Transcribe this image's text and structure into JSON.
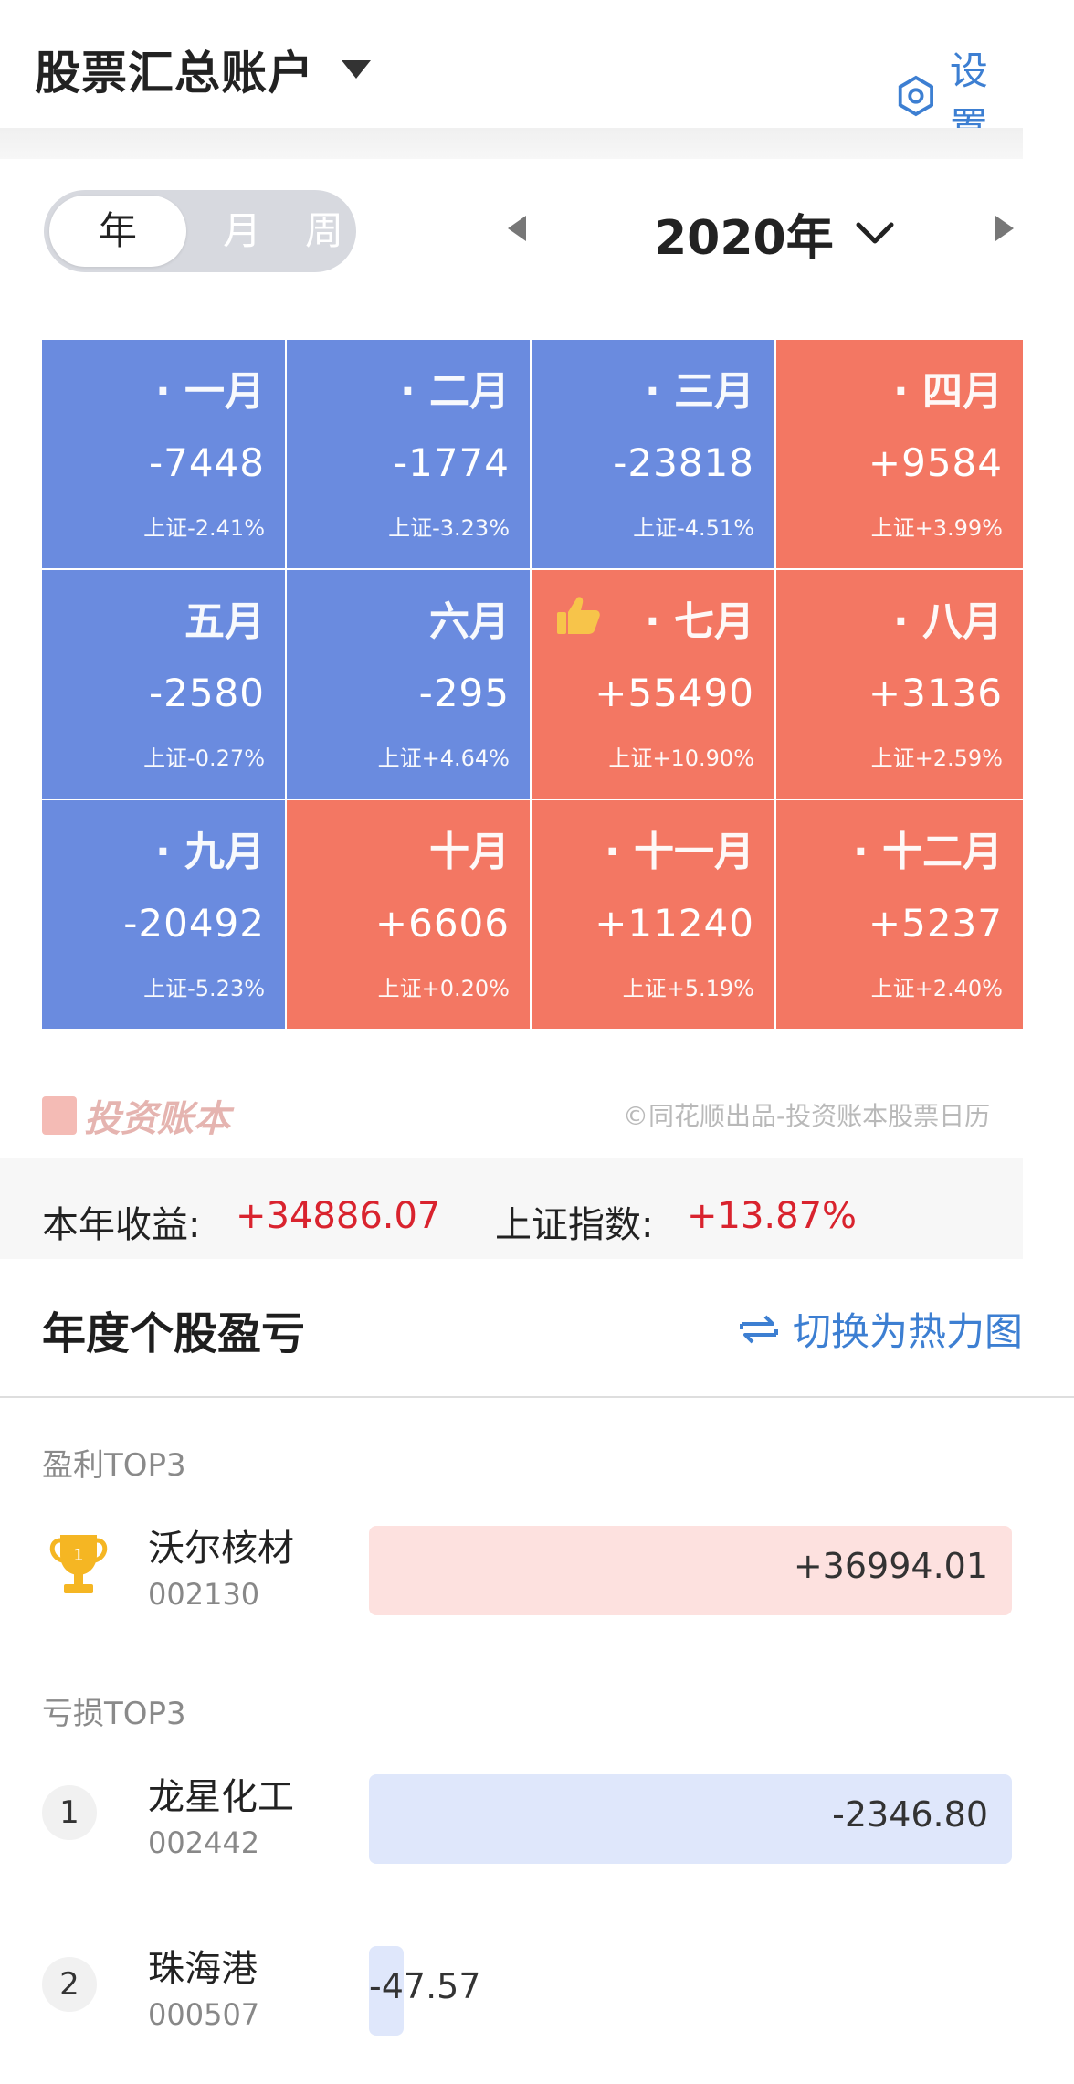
{
  "header": {
    "title": "股票汇总账户",
    "settings_label": "设置"
  },
  "period_tabs": [
    {
      "label": "年",
      "active": true
    },
    {
      "label": "月",
      "active": false
    },
    {
      "label": "周",
      "active": false
    }
  ],
  "year_label": "2020年",
  "months": [
    {
      "name": "· 一月",
      "value": "-7448",
      "index": "上证-2.41%",
      "trend": "down"
    },
    {
      "name": "· 二月",
      "value": "-1774",
      "index": "上证-3.23%",
      "trend": "down"
    },
    {
      "name": "· 三月",
      "value": "-23818",
      "index": "上证-4.51%",
      "trend": "down"
    },
    {
      "name": "· 四月",
      "value": "+9584",
      "index": "上证+3.99%",
      "trend": "up"
    },
    {
      "name": "五月",
      "value": "-2580",
      "index": "上证-0.27%",
      "trend": "down"
    },
    {
      "name": "六月",
      "value": "-295",
      "index": "上证+4.64%",
      "trend": "down"
    },
    {
      "name": "· 七月",
      "value": "+55490",
      "index": "上证+10.90%",
      "trend": "up",
      "best": true
    },
    {
      "name": "· 八月",
      "value": "+3136",
      "index": "上证+2.59%",
      "trend": "up"
    },
    {
      "name": "· 九月",
      "value": "-20492",
      "index": "上证-5.23%",
      "trend": "down"
    },
    {
      "name": "十月",
      "value": "+6606",
      "index": "上证+0.20%",
      "trend": "up"
    },
    {
      "name": "· 十一月",
      "value": "+11240",
      "index": "上证+5.19%",
      "trend": "up"
    },
    {
      "name": "· 十二月",
      "value": "+5237",
      "index": "上证+2.40%",
      "trend": "up"
    }
  ],
  "watermark": {
    "logo_text": "投资账本",
    "credit": "©同花顺出品-投资账本股票日历"
  },
  "summary": {
    "year_profit_label": "本年收益:",
    "year_profit_value": "+34886.07",
    "index_label": "上证指数:",
    "index_value": "+13.87%"
  },
  "stock_section": {
    "title": "年度个股盈亏",
    "switch_label": "切换为热力图",
    "profit_label": "盈利TOP3",
    "loss_label": "亏损TOP3",
    "profit_items": [
      {
        "rank": "1",
        "name": "沃尔核材",
        "code": "002130",
        "value": "+36994.01",
        "magnitude": 36994.01
      }
    ],
    "loss_items": [
      {
        "rank": "1",
        "name": "龙星化工",
        "code": "002442",
        "value": "-2346.80",
        "magnitude": 2346.8
      },
      {
        "rank": "2",
        "name": "珠海港",
        "code": "000507",
        "value": "-47.57",
        "magnitude": 47.57
      }
    ]
  },
  "colors": {
    "loss_cell": "#6a8bdf",
    "profit_cell": "#f37763",
    "accent_blue": "#3d7fd2",
    "red_text": "#d9232e"
  }
}
